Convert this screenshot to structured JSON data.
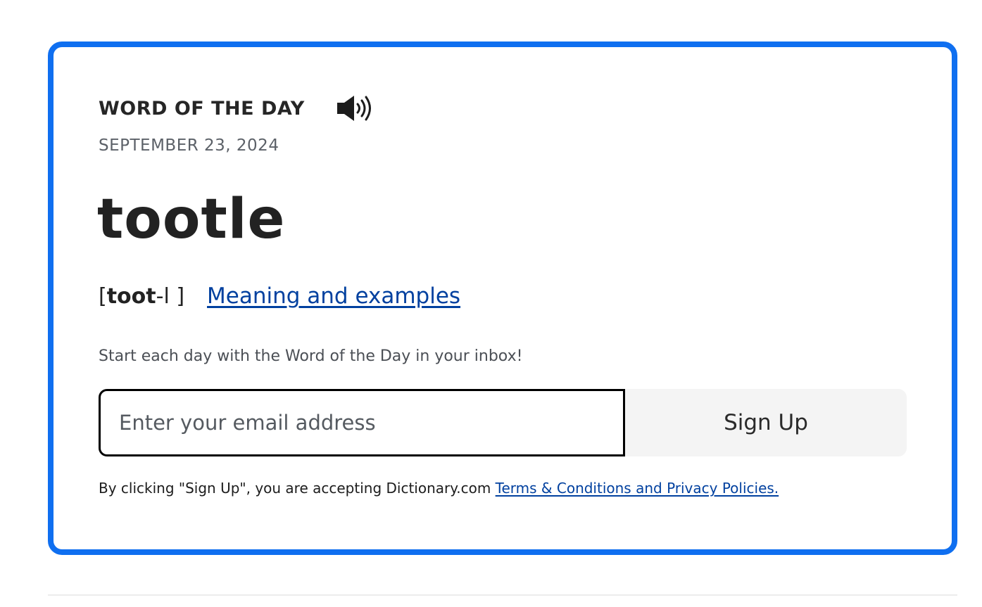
{
  "word_of_the_day": {
    "eyebrow": "WORD OF THE DAY",
    "audio_icon": "speaker-volume-icon",
    "date": "SEPTEMBER 23, 2024",
    "word": "tootle",
    "pronunciation": {
      "open": "[",
      "stressed": "toot",
      "rest": "-l ]"
    },
    "meaning_link": "Meaning and examples"
  },
  "signup": {
    "pitch": "Start each day with the Word of the Day in your inbox!",
    "email_placeholder": "Enter your email address",
    "email_value": "",
    "button_label": "Sign Up",
    "legal_text": "By clicking \"Sign Up\", you are accepting Dictionary.com ",
    "legal_link": "Terms & Conditions and Privacy Policies."
  },
  "colors": {
    "accent_border": "#0f6ff0",
    "link": "#00409f",
    "button_bg": "#f4f4f4"
  }
}
